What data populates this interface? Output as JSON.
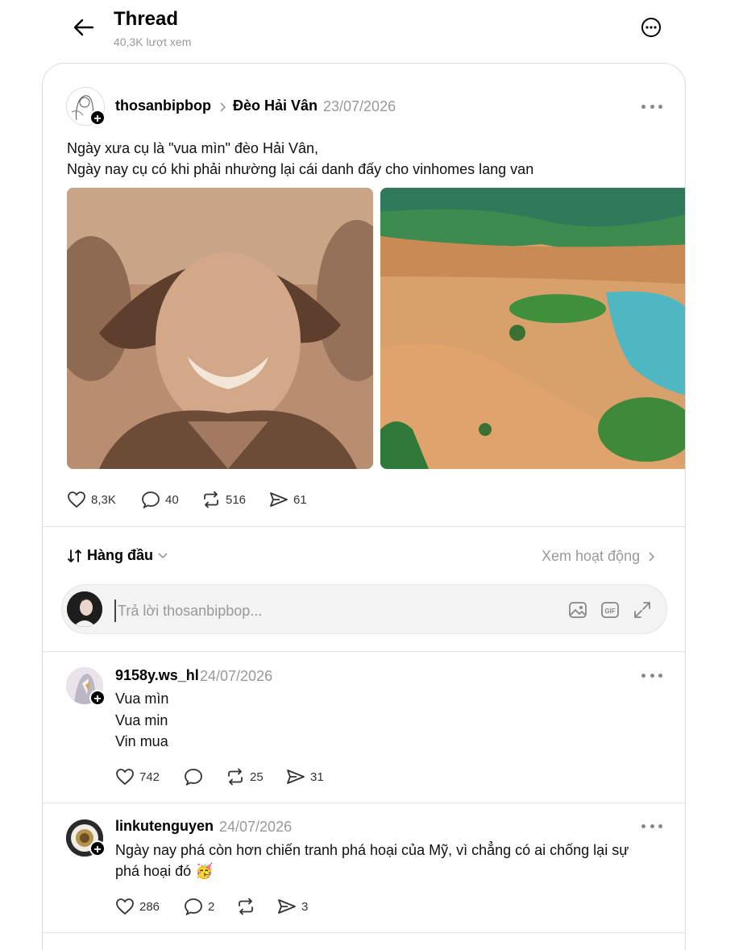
{
  "header": {
    "title": "Thread",
    "views": "40,3K lượt xem"
  },
  "post": {
    "username": "thosanbipbop",
    "location": "Đèo Hải Vân",
    "date": "23/07/2026",
    "lines": [
      "Ngày xưa cụ là \"vua mìn\" đèo Hải Vân,",
      "Ngày nay cụ có khi phải nhường lại cái danh đấy cho vinhomes lang van"
    ],
    "stats": {
      "likes": "8,3K",
      "comments": "40",
      "reposts": "516",
      "shares": "61"
    }
  },
  "sort": {
    "label": "Hàng đầu",
    "activity_link": "Xem hoạt động"
  },
  "reply_box": {
    "placeholder": "Trả lời thosanbipbop..."
  },
  "comments": [
    {
      "username": "9158y.ws_hl",
      "date": "24/07/2026",
      "lines": [
        "Vua mìn",
        "Vua min",
        "Vin mua"
      ],
      "stats": {
        "likes": "742",
        "comments": "",
        "reposts": "25",
        "shares": "31"
      }
    },
    {
      "username": "linkutenguyen",
      "date": "24/07/2026",
      "lines": [
        "Ngày nay phá còn hơn chiến tranh phá hoại của Mỹ, vì chẳng có ai chống lại sự",
        "phá hoại đó 🥳"
      ],
      "stats": {
        "likes": "286",
        "comments": "2",
        "reposts": "",
        "shares": "3"
      }
    }
  ]
}
